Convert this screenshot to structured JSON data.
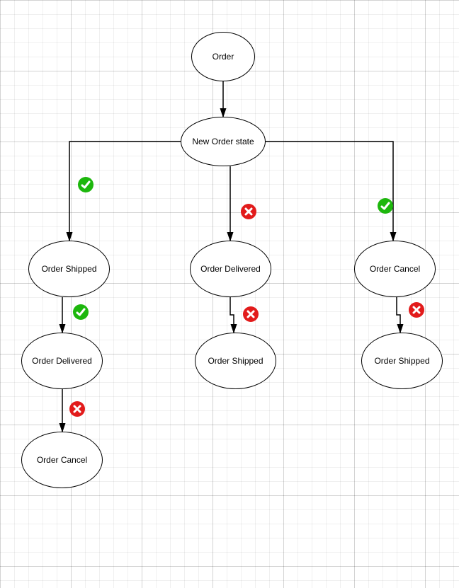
{
  "nodes": {
    "order": {
      "label": "Order"
    },
    "new_order_state": {
      "label": "New Order state"
    },
    "order_shipped_l": {
      "label": "Order Shipped"
    },
    "order_delivered_m": {
      "label": "Order Delivered"
    },
    "order_cancel_r": {
      "label": "Order Cancel"
    },
    "order_delivered_l": {
      "label": "Order Delivered"
    },
    "order_shipped_m": {
      "label": "Order Shipped"
    },
    "order_shipped_r": {
      "label": "Order Shipped"
    },
    "order_cancel_l": {
      "label": "Order Cancel"
    }
  },
  "marks": {
    "m1": "check",
    "m2": "cross",
    "m3": "check",
    "m4": "check",
    "m5": "cross",
    "m6": "cross",
    "m7": "cross"
  }
}
